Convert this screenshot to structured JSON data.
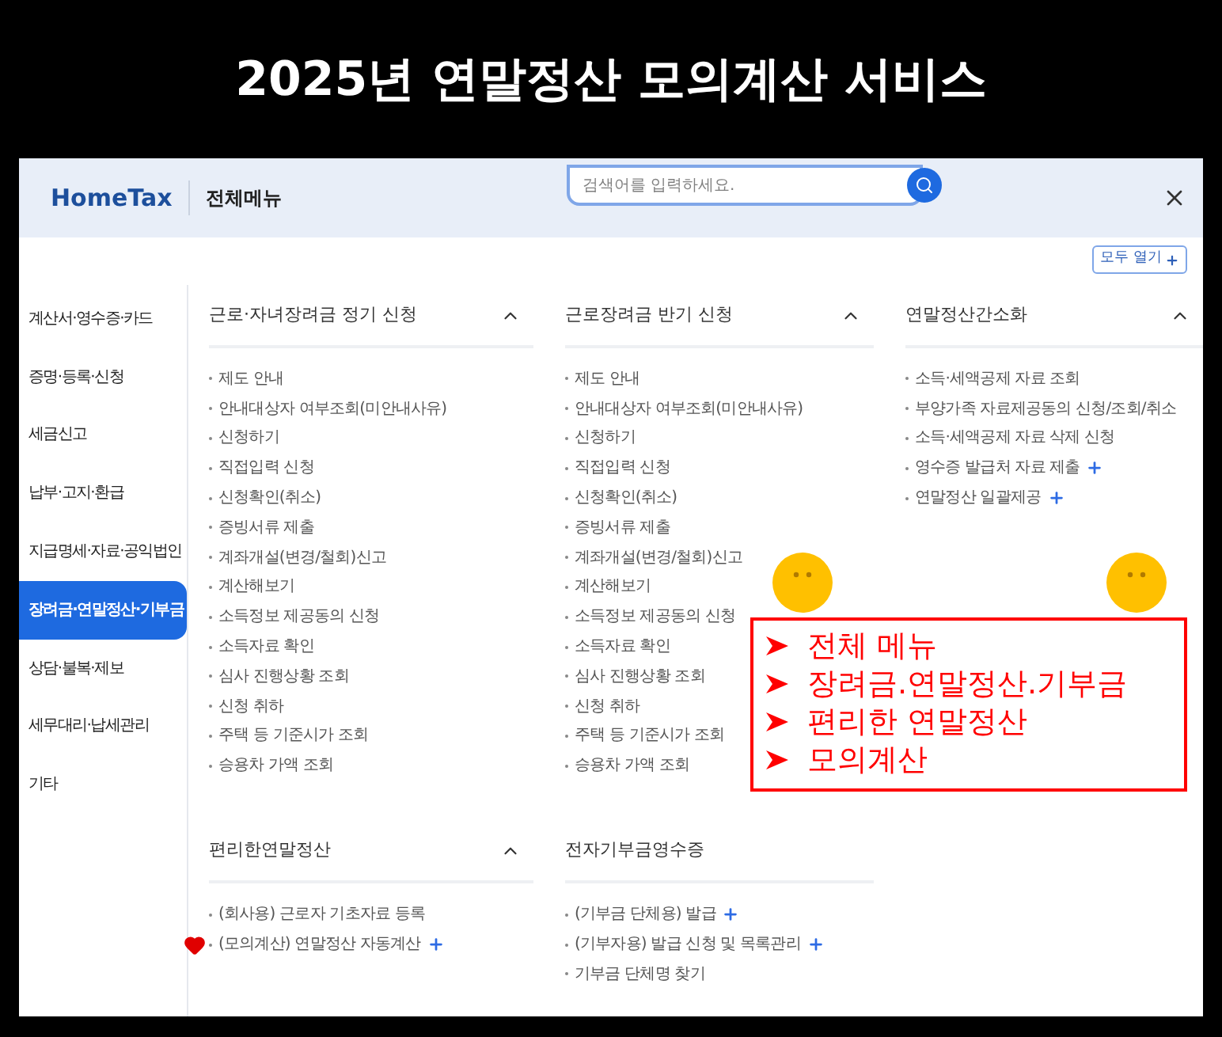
{
  "banner": {
    "title": "2025년 연말정산 모의계산 서비스"
  },
  "header": {
    "logo": "HomeTax",
    "title": "전체메뉴",
    "search": {
      "placeholder": "검색어를 입력하세요."
    }
  },
  "open_all_button": "모두 열기",
  "sidebar": {
    "items": [
      {
        "label": "계산서·영수증·카드",
        "selected": false
      },
      {
        "label": "증명·등록·신청",
        "selected": false
      },
      {
        "label": "세금신고",
        "selected": false
      },
      {
        "label": "납부·고지·환급",
        "selected": false
      },
      {
        "label": "지급명세·자료·공익법인",
        "selected": false
      },
      {
        "label": "장려금·연말정산·기부금",
        "selected": true
      },
      {
        "label": "상담·불복·제보",
        "selected": false
      },
      {
        "label": "세무대리·납세관리",
        "selected": false
      },
      {
        "label": "기타",
        "selected": false
      }
    ]
  },
  "sections": [
    {
      "title": "근로·자녀장려금 정기 신청",
      "expanded": true,
      "items": [
        {
          "label": "제도 안내",
          "plus": false,
          "marked": false
        },
        {
          "label": "안내대상자 여부조회(미안내사유)",
          "plus": false,
          "marked": false
        },
        {
          "label": "신청하기",
          "plus": false,
          "marked": false
        },
        {
          "label": "직접입력 신청",
          "plus": false,
          "marked": false
        },
        {
          "label": "신청확인(취소)",
          "plus": false,
          "marked": false
        },
        {
          "label": "증빙서류 제출",
          "plus": false,
          "marked": false
        },
        {
          "label": "계좌개설(변경/철회)신고",
          "plus": false,
          "marked": false
        },
        {
          "label": "계산해보기",
          "plus": false,
          "marked": false
        },
        {
          "label": "소득정보 제공동의 신청",
          "plus": false,
          "marked": false
        },
        {
          "label": "소득자료 확인",
          "plus": false,
          "marked": false
        },
        {
          "label": "심사 진행상황 조회",
          "plus": false,
          "marked": false
        },
        {
          "label": "신청 취하",
          "plus": false,
          "marked": false
        },
        {
          "label": "주택 등 기준시가 조회",
          "plus": false,
          "marked": false
        },
        {
          "label": "승용차 가액 조회",
          "plus": false,
          "marked": false
        }
      ]
    },
    {
      "title": "근로장려금 반기 신청",
      "expanded": true,
      "items": [
        {
          "label": "제도 안내",
          "plus": false,
          "marked": false
        },
        {
          "label": "안내대상자 여부조회(미안내사유)",
          "plus": false,
          "marked": false
        },
        {
          "label": "신청하기",
          "plus": false,
          "marked": false
        },
        {
          "label": "직접입력 신청",
          "plus": false,
          "marked": false
        },
        {
          "label": "신청확인(취소)",
          "plus": false,
          "marked": false
        },
        {
          "label": "증빙서류 제출",
          "plus": false,
          "marked": false
        },
        {
          "label": "계좌개설(변경/철회)신고",
          "plus": false,
          "marked": false
        },
        {
          "label": "계산해보기",
          "plus": false,
          "marked": false
        },
        {
          "label": "소득정보 제공동의 신청",
          "plus": false,
          "marked": false
        },
        {
          "label": "소득자료 확인",
          "plus": false,
          "marked": false
        },
        {
          "label": "심사 진행상황 조회",
          "plus": false,
          "marked": false
        },
        {
          "label": "신청 취하",
          "plus": false,
          "marked": false
        },
        {
          "label": "주택 등 기준시가 조회",
          "plus": false,
          "marked": false
        },
        {
          "label": "승용차 가액 조회",
          "plus": false,
          "marked": false
        }
      ]
    },
    {
      "title": "연말정산간소화",
      "expanded": true,
      "items": [
        {
          "label": "소득·세액공제 자료 조회",
          "plus": false,
          "marked": false
        },
        {
          "label": "부양가족 자료제공동의 신청/조회/취소",
          "plus": false,
          "marked": false
        },
        {
          "label": "소득·세액공제 자료 삭제 신청",
          "plus": false,
          "marked": false
        },
        {
          "label": "영수증 발급처 자료 제출",
          "plus": true,
          "marked": false
        },
        {
          "label": "연말정산 일괄제공",
          "plus": true,
          "marked": false
        }
      ]
    },
    {
      "title": "편리한연말정산",
      "expanded": true,
      "items": [
        {
          "label": "(회사용) 근로자 기초자료 등록",
          "plus": false,
          "marked": false
        },
        {
          "label": "(모의계산) 연말정산 자동계산",
          "plus": true,
          "marked": true
        }
      ]
    },
    {
      "title": "전자기부금영수증",
      "items": [
        {
          "label": "(기부금 단체용) 발급",
          "plus": true,
          "marked": false
        },
        {
          "label": "(기부자용) 발급 신청 및 목록관리",
          "plus": true,
          "marked": false
        },
        {
          "label": "기부금 단체명 찾기",
          "plus": false,
          "marked": false
        }
      ]
    }
  ],
  "annotation": {
    "lines": [
      "전체 메뉴",
      "장려금.연말정산.기부금",
      "편리한 연말정산",
      "모의계산"
    ]
  }
}
